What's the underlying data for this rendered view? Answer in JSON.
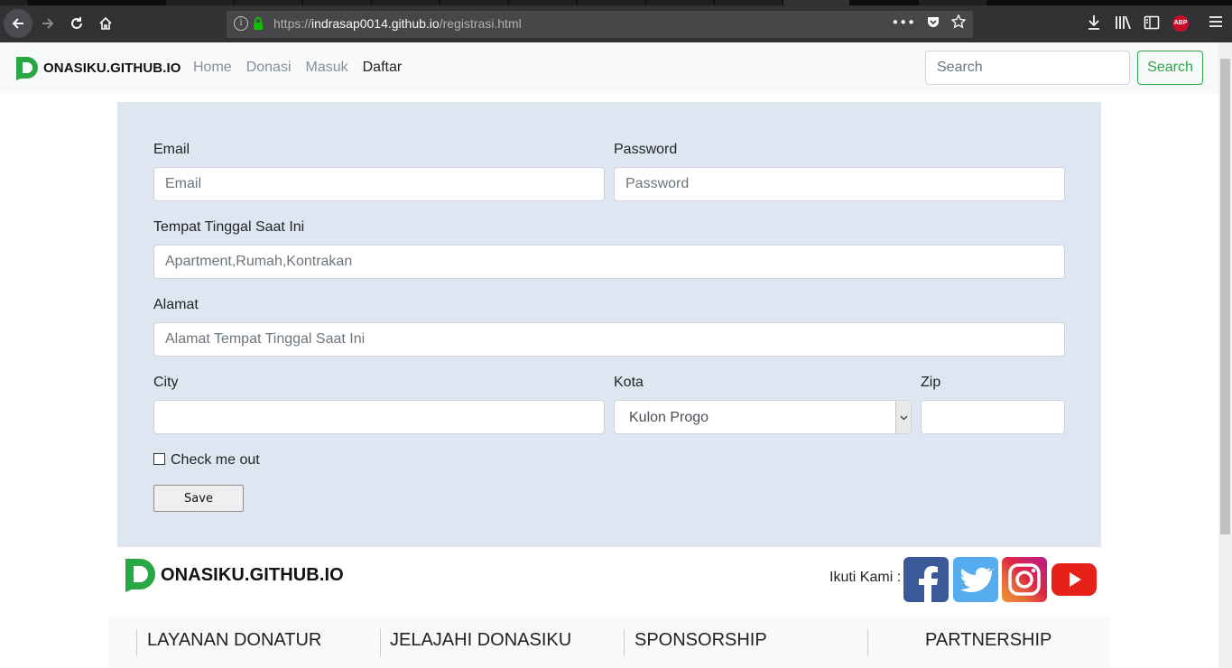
{
  "browser": {
    "url_scheme": "https://",
    "url_host": "indrasap0014.github.io",
    "url_path": "/registrasi.html",
    "abp_label": "ABP"
  },
  "navbar": {
    "brand": "ONASIKU.GITHUB.IO",
    "links": [
      "Home",
      "Donasi",
      "Masuk",
      "Daftar"
    ],
    "active_link": "Daftar",
    "search_placeholder": "Search",
    "search_button": "Search",
    "brand_color": "#28a745"
  },
  "form": {
    "email_label": "Email",
    "email_placeholder": "Email",
    "password_label": "Password",
    "password_placeholder": "Password",
    "residence_label": "Tempat Tinggal Saat Ini",
    "residence_placeholder": "Apartment,Rumah,Kontrakan",
    "address_label": "Alamat",
    "address_placeholder": "Alamat Tempat Tinggal Saat Ini",
    "city_label": "City",
    "city_value": "",
    "kota_label": "Kota",
    "kota_selected": "Kulon Progo",
    "zip_label": "Zip",
    "zip_value": "",
    "checkbox_label": "Check me out",
    "checkbox_checked": false,
    "save_button": "Save"
  },
  "footer": {
    "brand": "ONASIKU.GITHUB.IO",
    "follow_label": "Ikuti Kami :",
    "social_icons": [
      "facebook-icon",
      "twitter-icon",
      "instagram-icon",
      "youtube-icon"
    ],
    "columns": [
      "LAYANAN DONATUR",
      "JELAJAHI DONASIKU",
      "SPONSORSHIP",
      "PARTNERSHIP"
    ]
  }
}
